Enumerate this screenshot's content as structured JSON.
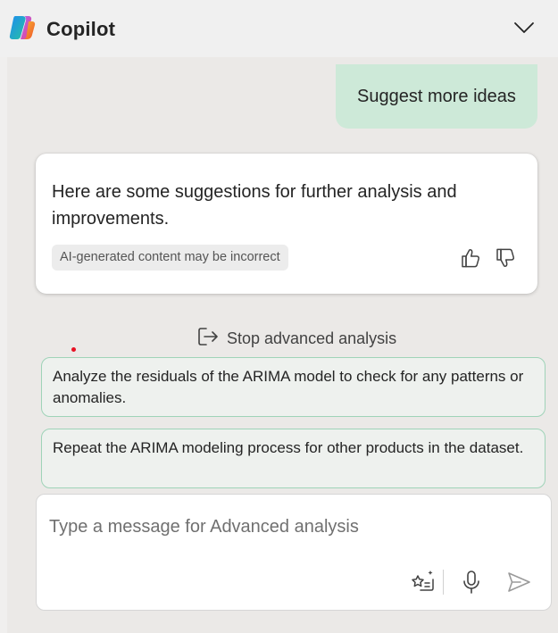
{
  "header": {
    "title": "Copilot",
    "logo_icon": "copilot-logo",
    "collapse_icon": "chevron-down-icon"
  },
  "conversation": {
    "user_message": "Suggest more ideas",
    "bot_message": "Here are some suggestions for further analysis and improvements.",
    "disclaimer": "AI-generated content may be incorrect",
    "feedback_icons": [
      "thumbs-up-icon",
      "thumbs-down-icon"
    ]
  },
  "stop_action": {
    "label": "Stop advanced analysis",
    "icon": "exit-icon"
  },
  "suggestions": [
    "Analyze the residuals of the ARIMA model to check for any patterns or anomalies.",
    "Repeat the ARIMA modeling process for other products in the dataset."
  ],
  "composer": {
    "placeholder": "Type a message for Advanced analysis",
    "value": "",
    "icons": [
      "prompt-guide-icon",
      "microphone-icon",
      "send-icon"
    ]
  },
  "colors": {
    "user_bubble": "#cde9d8",
    "suggestion_border": "#9fd3b8",
    "panel_background": "#ebe9e7"
  }
}
